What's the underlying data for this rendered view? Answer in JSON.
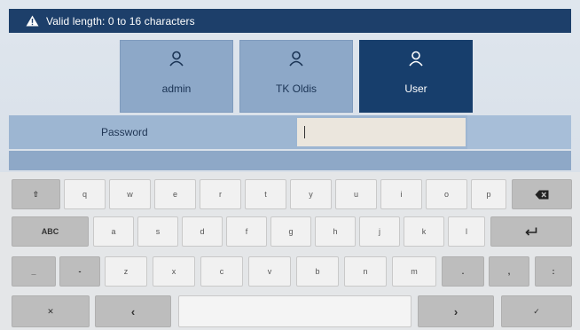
{
  "header": {
    "message": "Valid length: 0 to 16 characters",
    "icon": "warning-icon",
    "background": "#1d3f6a"
  },
  "users": [
    {
      "label": "admin",
      "icon": "user-icon",
      "selected": false
    },
    {
      "label": "TK Oldis",
      "icon": "user-icon",
      "selected": false
    },
    {
      "label": "User",
      "icon": "user-icon",
      "selected": true
    }
  ],
  "password": {
    "label": "Password",
    "value": ""
  },
  "keyboard": {
    "row1": [
      "⇧",
      "q",
      "w",
      "e",
      "r",
      "t",
      "y",
      "u",
      "i",
      "o",
      "p"
    ],
    "row2": [
      "ABC",
      "a",
      "s",
      "d",
      "f",
      "g",
      "h",
      "j",
      "k",
      "l"
    ],
    "row3": [
      "_",
      "-",
      "z",
      "x",
      "c",
      "v",
      "b",
      "n",
      "m",
      ".",
      ",",
      ":"
    ],
    "row4": {
      "cancel": "✕",
      "left": "‹",
      "space": "",
      "right": "›",
      "confirm": "✓"
    },
    "backspace_icon": "backspace-icon",
    "enter_icon": "enter-icon"
  },
  "colors": {
    "selected_tile": "#173e6c",
    "tile": "#8da8c8",
    "password_bar": "#9db6d2"
  }
}
